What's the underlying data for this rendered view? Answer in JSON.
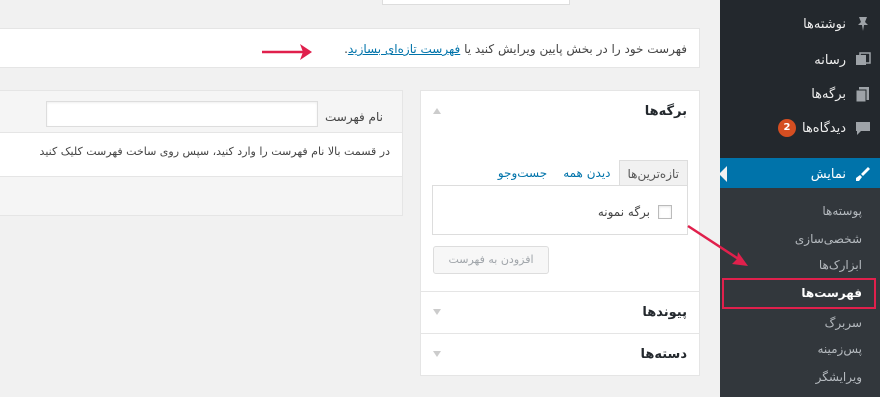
{
  "sidebar": {
    "items": [
      {
        "label": "نوشته‌ها",
        "icon": "pin-icon"
      },
      {
        "label": "رسانه",
        "icon": "media-icon"
      },
      {
        "label": "برگه‌ها",
        "icon": "pages-icon"
      },
      {
        "label": "دیدگاه‌ها",
        "icon": "comments-icon",
        "badge": "2"
      },
      {
        "label": "نمایش",
        "icon": "appearance-icon",
        "active": true
      }
    ],
    "submenu": [
      "پوسته‌ها",
      "شخصی‌سازی",
      "ابزارک‌ها",
      "فهرست‌ها",
      "سربرگ",
      "پس‌زمینه",
      "ویرایشگر"
    ],
    "active_color": "#0073aa",
    "badge_color": "#d54e21"
  },
  "notice": {
    "text": "فهرست خود را در بخش پایین ویرایش کنید یا",
    "link": "فهرست تازه‌ای بسازید",
    "end": "."
  },
  "pages_box": {
    "title": "برگه‌ها",
    "tabs": [
      "تازه‌ترین‌ها",
      "دیدن همه",
      "جست‌وجو"
    ],
    "active_tab": "تازه‌ترین‌ها",
    "items": [
      "برگه نمونه"
    ],
    "add_button": "افزودن به فهرست"
  },
  "links_box": {
    "title": "پیوندها"
  },
  "categories_box": {
    "title": "دسته‌ها"
  },
  "editor": {
    "name_label": "نام فهرست",
    "name_value": "",
    "instructions": "در قسمت بالا نام فهرست را وارد کنید، سپس روی ساخت فهرست کلیک کنید"
  },
  "annotation_color": "#e0204c"
}
